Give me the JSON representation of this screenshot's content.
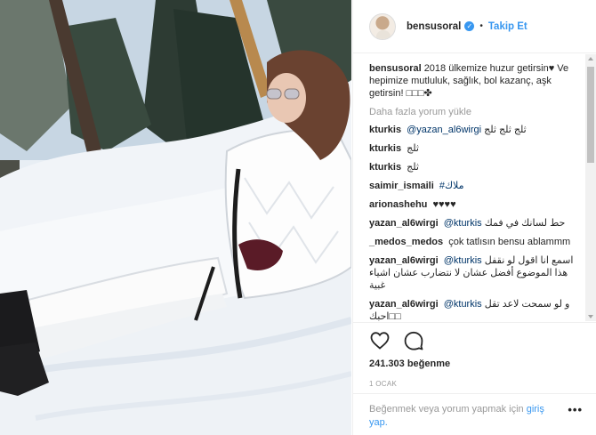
{
  "post": {
    "image_alt": "Woman in white ski outfit sitting in snow",
    "colors": {
      "accent": "#3897f0",
      "text": "#262626",
      "muted": "#999999",
      "border": "#efefef"
    }
  },
  "header": {
    "username": "bensusoral",
    "separator": "•",
    "follow_label": "Takip Et"
  },
  "caption": {
    "username": "bensusoral",
    "text": "2018 ülkemize huzur getirsin♥ Ve hepimize mutluluk, sağlık, bol kazanç, aşk getirsin! □□□✤"
  },
  "load_more_label": "Daha fazla yorum yükle",
  "comments": [
    {
      "user": "kturkis",
      "mention": "@yazan_al6wirgi",
      "text": "ثلج ثلج ثلج"
    },
    {
      "user": "kturkis",
      "mention": "",
      "text": "ثلج"
    },
    {
      "user": "kturkis",
      "mention": "",
      "text": "ثلج"
    },
    {
      "user": "saimir_ismaili",
      "mention": "#ملاك",
      "text": ""
    },
    {
      "user": "arionashehu",
      "mention": "",
      "text": "♥♥♥♥"
    },
    {
      "user": "yazan_al6wirgi",
      "mention": "@kturkis",
      "text": "حط لسانك في فمك"
    },
    {
      "user": "_medos_medos",
      "mention": "",
      "text": "çok tatlısın bensu ablammm"
    },
    {
      "user": "yazan_al6wirgi",
      "mention": "@kturkis",
      "text": "اسمع انا اقول لو نقفل هذا الموضوع أفضل عشان لا نتضارب عشان اشياء غبية"
    },
    {
      "user": "yazan_al6wirgi",
      "mention": "@kturkis",
      "text": "و لو سمحت لاعد تقل □□احبك"
    }
  ],
  "actions": {
    "like_icon": "heart-icon",
    "comment_icon": "comment-icon",
    "likes_text": "241.303 beğenme",
    "date_text": "1 OCAK"
  },
  "footer": {
    "prompt_text": "Beğenmek veya yorum yapmak için",
    "login_label": "giriş yap.",
    "more_label": "•••"
  }
}
